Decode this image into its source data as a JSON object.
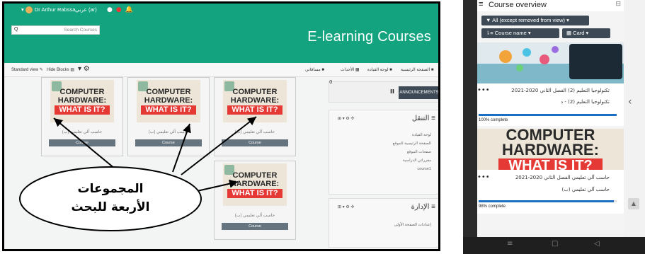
{
  "desktop": {
    "topbar": {
      "user_name": "Dr Arthur Rabssa",
      "language": "عربي (ar)",
      "icons": [
        "bell-icon",
        "chat-icon",
        "notification-icon"
      ]
    },
    "search_placeholder": "Search Courses",
    "site_title": "E-learning Courses",
    "navbar": {
      "standard_view": "Standard view",
      "hide_blocks": "Hide Blocks",
      "home": "الصفحة الرئيسية",
      "dashboard": "لوحة القيادة",
      "events": "الأحداث",
      "my_courses": "مساقاتي"
    },
    "course_cards": [
      {
        "image_line1": "COMPUTER",
        "image_line2": "HARDWARE:",
        "image_line3": "WHAT IS IT?",
        "caption": "حاسب آلي تعليمي (ب)",
        "button": "Course"
      },
      {
        "image_line1": "COMPUTER",
        "image_line2": "HARDWARE:",
        "image_line3": "WHAT IS IT?",
        "caption": "حاسب آلي تعليمي (ب)",
        "button": "Course"
      },
      {
        "image_line1": "COMPUTER",
        "image_line2": "HARDWARE:",
        "image_line3": "WHAT IS IT?",
        "caption": "حاسب آلي تعليمي (ب)",
        "button": "Course"
      },
      {
        "image_line1": "COMPUTER",
        "image_line2": "HARDWARE:",
        "image_line3": "WHAT IS IT?",
        "caption": "حاسب آلي تعليمي (ب)",
        "button": "Course"
      }
    ],
    "announcements": {
      "count": "0",
      "button": "ANNOUNCEMENTS"
    },
    "navigation_block": {
      "title": "التنقل",
      "items": [
        "لوحة القيادة",
        "الصفحة الرئيسية للموقع",
        "صفحات الموقع",
        "مقرراتي الدراسية",
        "course1"
      ]
    },
    "admin_block": {
      "title": "الإدارة",
      "items": [
        "إعدادات الصفحة الأولى"
      ]
    },
    "callout": {
      "line1": "المجموعات",
      "line2": "الأربعة للبحث"
    }
  },
  "mobile": {
    "header_title": "Course overview",
    "filter_button": "All (except removed from view)",
    "sort_button": "Course name",
    "view_button": "Card",
    "courses": [
      {
        "title": "تكنولوجيا التعليم (2) الفصل الثاني 2020-2021",
        "subtitle": "تكنولوجيا التعليم (2) - د",
        "progress": 100,
        "progress_label": "100% complete"
      },
      {
        "image_line1": "COMPUTER",
        "image_line2": "HARDWARE:",
        "image_line3": "WHAT IS IT?",
        "title": "حاسب آلي تعليمي الفصل الثاني 2020-2021",
        "subtitle": "حاسب آلي تعليمي (ب)",
        "progress": 98,
        "progress_label": "98% complete"
      }
    ]
  }
}
